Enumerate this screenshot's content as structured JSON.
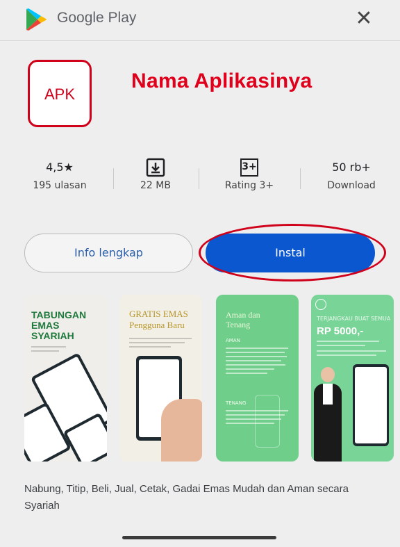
{
  "header": {
    "title": "Google Play",
    "close_icon": "close-icon"
  },
  "app": {
    "icon_text": "APK",
    "name": "Nama Aplikasinya",
    "highlight_color": "#d0021b"
  },
  "stats": [
    {
      "top": "4,5★",
      "bottom": "195 ulasan"
    },
    {
      "top_icon": "download-icon",
      "bottom": "22 MB"
    },
    {
      "top_icon": "age-rating-icon",
      "badge": "3+",
      "bottom": "Rating 3+"
    },
    {
      "top": "50 rb+",
      "bottom": "Download"
    }
  ],
  "buttons": {
    "info": "Info lengkap",
    "install": "Instal",
    "install_color": "#0b57d0"
  },
  "screenshots": [
    {
      "heading": "TABUNGAN EMAS SYARIAH"
    },
    {
      "heading": "GRATIS EMAS",
      "subheading": "Pengguna Baru"
    },
    {
      "heading": "Aman dan Tenang",
      "label1": "AMAN",
      "label2": "TENANG"
    },
    {
      "kicker": "TERJANGKAU BUAT SEMUA",
      "heading": "RP 5000,-"
    }
  ],
  "description": "Nabung, Titip, Beli, Jual, Cetak, Gadai Emas Mudah dan Aman secara Syariah"
}
